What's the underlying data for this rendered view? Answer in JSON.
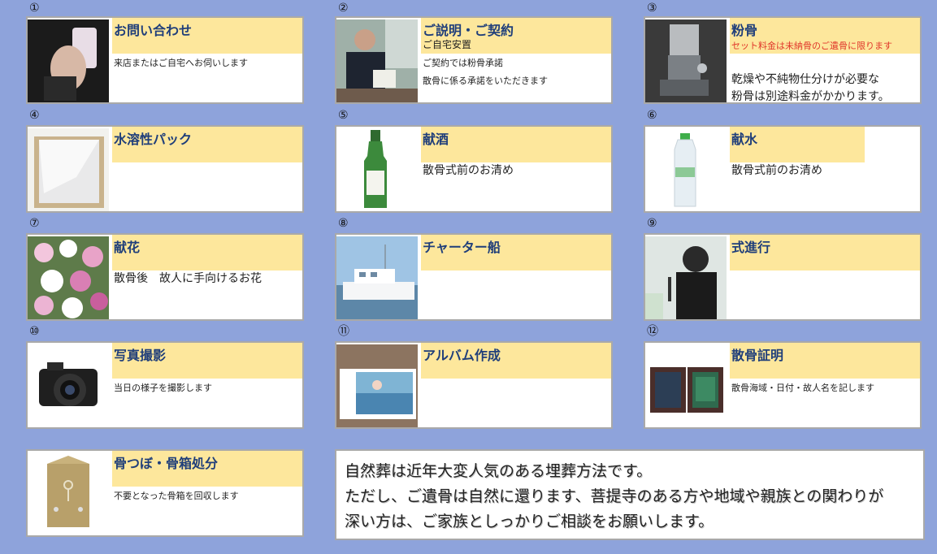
{
  "cards": [
    {
      "num": "①",
      "title": "お問い合わせ",
      "sub": "",
      "lines": [
        "来店またはご自宅へお伺いします"
      ]
    },
    {
      "num": "②",
      "title": "ご説明・ご契約",
      "sub": "ご自宅安置",
      "lines": [
        "ご契約では粉骨承諾",
        "散骨に係る承諾をいただきます"
      ]
    },
    {
      "num": "③",
      "title": "粉骨",
      "sub": "セット料金は未納骨のご遺骨に限ります",
      "lines": [
        "乾燥や不純物仕分けが必要な",
        "粉骨は別途料金がかかります。"
      ]
    },
    {
      "num": "④",
      "title": "水溶性パック",
      "sub": "",
      "lines": []
    },
    {
      "num": "⑤",
      "title": "献酒",
      "sub": "",
      "lines": [
        "散骨式前のお清め"
      ]
    },
    {
      "num": "⑥",
      "title": "献水",
      "sub": "",
      "lines": [
        "散骨式前のお清め"
      ]
    },
    {
      "num": "⑦",
      "title": "献花",
      "sub": "",
      "lines": [
        "散骨後　故人に手向けるお花"
      ]
    },
    {
      "num": "⑧",
      "title": "チャーター船",
      "sub": "",
      "lines": []
    },
    {
      "num": "⑨",
      "title": "式進行",
      "sub": "",
      "lines": []
    },
    {
      "num": "⑩",
      "title": "写真撮影",
      "sub": "",
      "lines": [
        "当日の様子を撮影します"
      ]
    },
    {
      "num": "⑪",
      "title": "アルバム作成",
      "sub": "",
      "lines": []
    },
    {
      "num": "⑫",
      "title": "散骨証明",
      "sub": "",
      "lines": [
        "散骨海域・日付・故人名を記します"
      ]
    },
    {
      "num": "",
      "title": "骨つぼ・骨箱処分",
      "sub": "",
      "lines": [
        "不要となった骨箱を回収します"
      ]
    }
  ],
  "info": {
    "line1": "自然葬は近年大変人気のある埋葬方法です。",
    "line2": "ただし、ご遺骨は自然に還ります、菩提寺のある方や地域や親族との関わりが",
    "line3": "深い方は、ご家族としっかりご相談をお願いします。"
  },
  "colors": {
    "background": "#8ea3db",
    "title_band": "#fde79c",
    "title_text": "#1f3e7a",
    "warning_text": "#e0362a"
  }
}
